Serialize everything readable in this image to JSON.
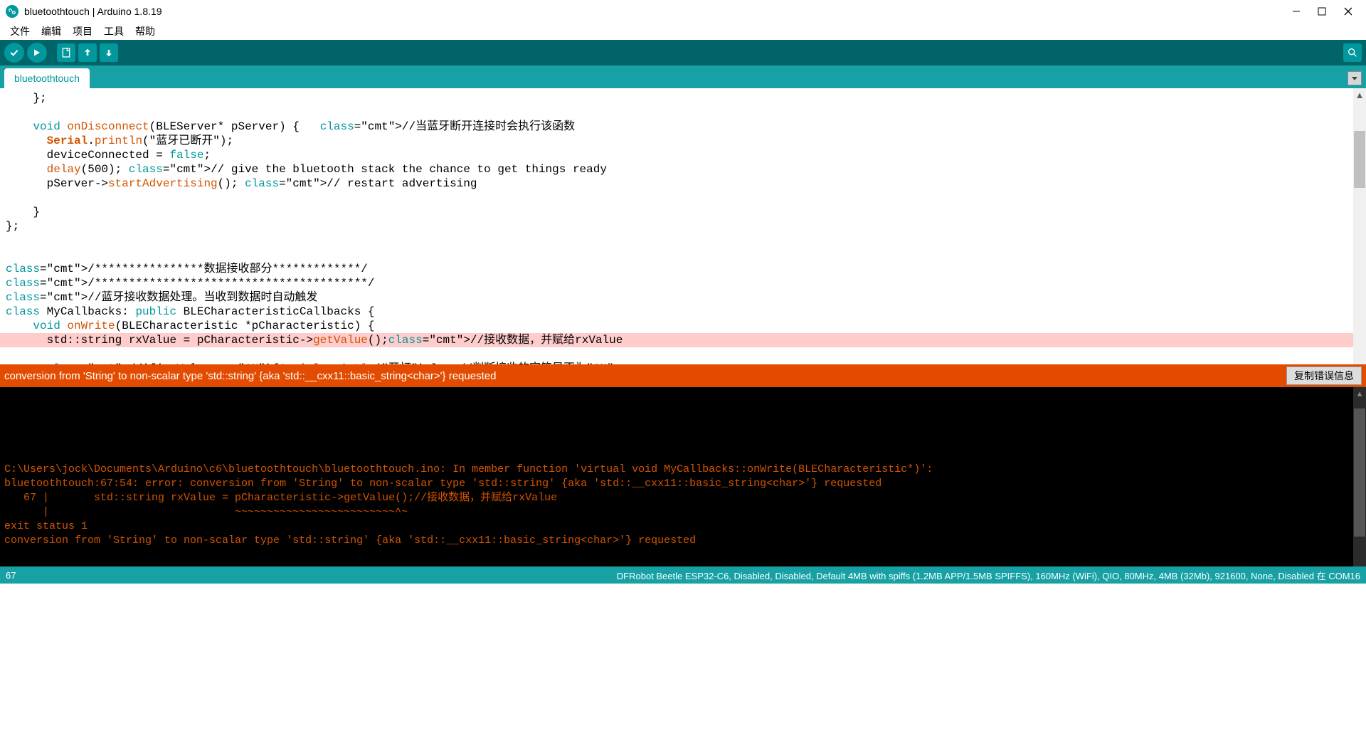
{
  "window": {
    "title": "bluetoothtouch | Arduino 1.8.19"
  },
  "menu": {
    "file": "文件",
    "edit": "编辑",
    "sketch": "项目",
    "tools": "工具",
    "help": "帮助"
  },
  "tab": {
    "name": "bluetoothtouch"
  },
  "code": {
    "lines": [
      "    };",
      "",
      "    void onDisconnect(BLEServer* pServer) {   //当蓝牙断开连接时会执行该函数",
      "      Serial.println(\"蓝牙已断开\");",
      "      deviceConnected = false;",
      "      delay(500); // give the bluetooth stack the chance to get things ready",
      "      pServer->startAdvertising(); // restart advertising",
      "",
      "    }",
      "};",
      "",
      "",
      "/****************数据接收部分*************/",
      "/****************************************/",
      "//蓝牙接收数据处理。当收到数据时自动触发",
      "class MyCallbacks: public BLECharacteristicCallbacks {",
      "    void onWrite(BLECharacteristic *pCharacteristic) {",
      "      std::string rxValue = pCharacteristic->getValue();//接收数据，并赋给rxValue",
      "",
      "      //if(rxValue == \"ON\"){Serial.println(\"开灯\");}   //判断接收的字符是否为\"ON\""
    ]
  },
  "error_bar": {
    "message": "conversion from 'String' to non-scalar type 'std::string' {aka 'std::__cxx11::basic_string<char>'} requested",
    "copy_btn": "复制错误信息"
  },
  "console": {
    "lines": [
      "",
      "",
      "",
      "",
      "",
      "C:\\Users\\jock\\Documents\\Arduino\\c6\\bluetoothtouch\\bluetoothtouch.ino: In member function 'virtual void MyCallbacks::onWrite(BLECharacteristic*)':",
      "bluetoothtouch:67:54: error: conversion from 'String' to non-scalar type 'std::string' {aka 'std::__cxx11::basic_string<char>'} requested",
      "   67 |       std::string rxValue = pCharacteristic->getValue();//接收数据，并赋给rxValue",
      "      |                             ~~~~~~~~~~~~~~~~~~~~~~~~~^~",
      "exit status 1",
      "conversion from 'String' to non-scalar type 'std::string' {aka 'std::__cxx11::basic_string<char>'} requested"
    ]
  },
  "status": {
    "left": "67",
    "right": "DFRobot Beetle ESP32-C6, Disabled, Disabled, Default 4MB with spiffs (1.2MB APP/1.5MB SPIFFS), 160MHz (WiFi), QIO, 80MHz, 4MB (32Mb), 921600, None, Disabled 在 COM16"
  }
}
